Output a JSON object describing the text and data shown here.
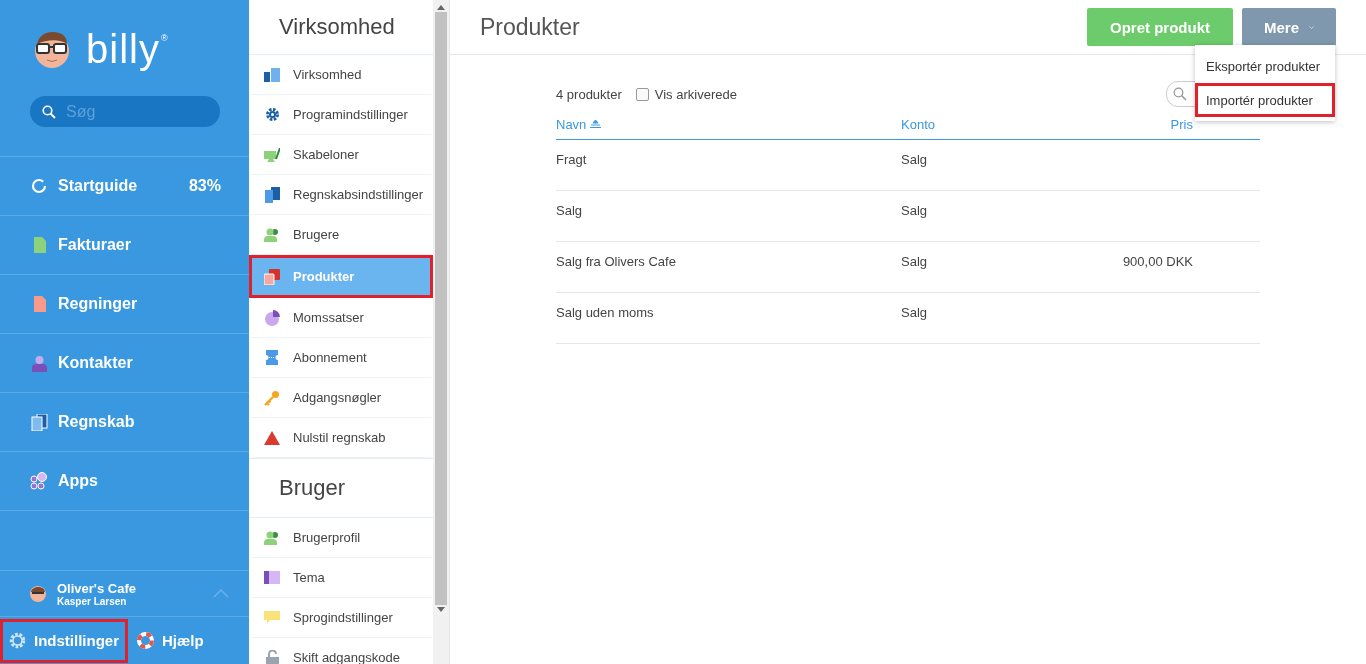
{
  "sidebar": {
    "brand": "billy",
    "brand_mark": "®",
    "search": {
      "placeholder": "Søg"
    },
    "items": [
      {
        "label": "Startguide",
        "badge": "83%"
      },
      {
        "label": "Fakturaer"
      },
      {
        "label": "Regninger"
      },
      {
        "label": "Kontakter"
      },
      {
        "label": "Regnskab"
      },
      {
        "label": "Apps"
      }
    ],
    "account": {
      "company": "Oliver's Cafe",
      "user": "Kasper Larsen"
    },
    "footer": [
      {
        "label": "Indstillinger",
        "highlighted": true
      },
      {
        "label": "Hjælp",
        "highlighted": false
      }
    ]
  },
  "settings_nav": {
    "sections": [
      {
        "title": "Virksomhed",
        "items": [
          {
            "label": "Virksomhed",
            "selected": false,
            "highlighted": false
          },
          {
            "label": "Programindstillinger",
            "selected": false,
            "highlighted": false
          },
          {
            "label": "Skabeloner",
            "selected": false,
            "highlighted": false
          },
          {
            "label": "Regnskabsindstillinger",
            "selected": false,
            "highlighted": false
          },
          {
            "label": "Brugere",
            "selected": false,
            "highlighted": false
          },
          {
            "label": "Produkter",
            "selected": true,
            "highlighted": true
          },
          {
            "label": "Momssatser",
            "selected": false,
            "highlighted": false
          },
          {
            "label": "Abonnement",
            "selected": false,
            "highlighted": false
          },
          {
            "label": "Adgangsnøgler",
            "selected": false,
            "highlighted": false
          },
          {
            "label": "Nulstil regnskab",
            "selected": false,
            "highlighted": false
          }
        ]
      },
      {
        "title": "Bruger",
        "items": [
          {
            "label": "Brugerprofil",
            "selected": false,
            "highlighted": false
          },
          {
            "label": "Tema",
            "selected": false,
            "highlighted": false
          },
          {
            "label": "Sprogindstillinger",
            "selected": false,
            "highlighted": false
          },
          {
            "label": "Skift adgangskode",
            "selected": false,
            "highlighted": false
          }
        ]
      }
    ]
  },
  "page": {
    "title": "Produkter",
    "create_button": "Opret produkt",
    "more_button": "Mere",
    "more_menu": [
      {
        "label": "Eksportér produkter",
        "highlighted": false
      },
      {
        "label": "Importér produkter",
        "highlighted": true
      }
    ],
    "count": "4 produkter",
    "show_archived": {
      "label": "Vis arkiverede",
      "checked": false
    },
    "table": {
      "columns": [
        {
          "label": "Navn",
          "sorted": true
        },
        {
          "label": "Konto",
          "sorted": false
        },
        {
          "label": "Pris",
          "sorted": false
        }
      ],
      "rows": [
        {
          "name": "Fragt",
          "account": "Salg"
        },
        {
          "name": "Salg",
          "account": "Salg"
        },
        {
          "name": "Salg fra Olivers Cafe",
          "account": "Salg",
          "price": "900,00 DKK"
        },
        {
          "name": "Salg uden moms",
          "account": "Salg"
        }
      ]
    }
  }
}
